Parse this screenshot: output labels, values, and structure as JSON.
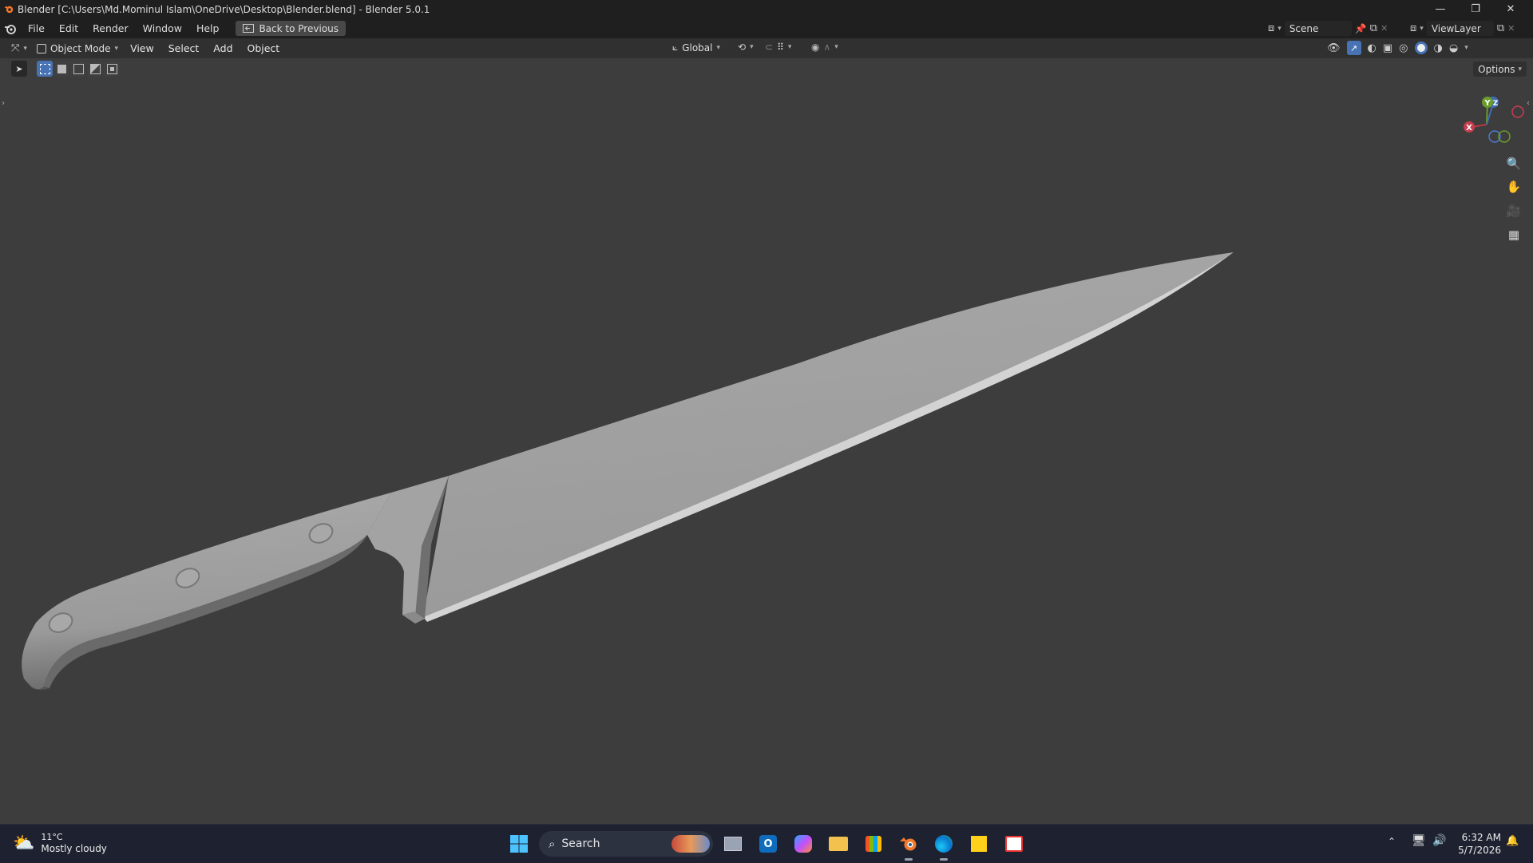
{
  "window": {
    "title": "Blender [C:\\Users\\Md.Mominul Islam\\OneDrive\\Desktop\\Blender.blend] - Blender 5.0.1"
  },
  "menu": {
    "items": [
      "File",
      "Edit",
      "Render",
      "Window",
      "Help"
    ],
    "back_button": "Back to Previous"
  },
  "scene": {
    "name": "Scene",
    "view_layer": "ViewLayer"
  },
  "viewport_header": {
    "mode": "Object Mode",
    "menus": [
      "View",
      "Select",
      "Add",
      "Object"
    ],
    "orientation": "Global",
    "options_label": "Options"
  },
  "gizmo": {
    "axes": [
      "Y",
      "Z",
      "X"
    ]
  },
  "taskbar": {
    "weather_temp": "11°C",
    "weather_desc": "Mostly cloudy",
    "search_label": "Search",
    "time": "6:32 AM",
    "date": "5/7/2026"
  },
  "colors": {
    "accent": "#4772b3",
    "viewport_bg": "#3d3d3d",
    "header_bg": "#303030",
    "topbar_bg": "#1f1f1f"
  }
}
